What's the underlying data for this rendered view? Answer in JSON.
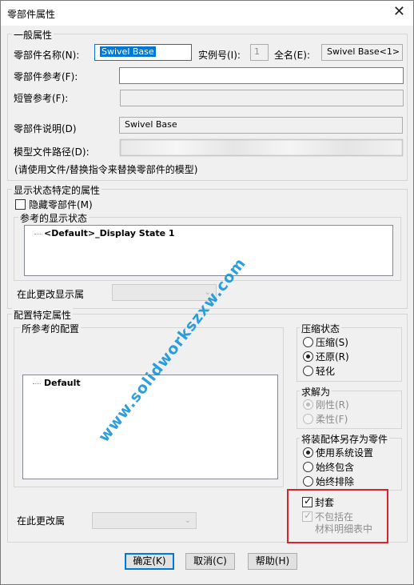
{
  "window": {
    "title": "零部件属性",
    "close_glyph": "✕"
  },
  "general": {
    "legend": "一般属性",
    "name_label": "零部件名称(N):",
    "name_value": "Swivel Base",
    "instance_label": "实例号(I):",
    "instance_value": "1",
    "fullname_label": "全名(E):",
    "fullname_value": "Swivel Base<1>",
    "ref_label": "零部件参考(F):",
    "ref_value": "",
    "short_ref_label": "短管参考(F):",
    "short_ref_value": "",
    "desc_label": "零部件说明(D)",
    "desc_value": "Swivel Base",
    "path_label": "模型文件路径(D):",
    "path_hint": "(请使用文件/替换指令来替换零部件的模型)"
  },
  "display": {
    "legend": "显示状态特定的属性",
    "hide_label": "隐藏零部件(M)",
    "ref_states_label": "参考的显示状态",
    "states": [
      "<Default>_Display State 1"
    ],
    "change_label": "在此更改显示属"
  },
  "config": {
    "legend": "配置特定属性",
    "ref_configs_label": "所参考的配置",
    "configs": [
      "Default"
    ],
    "change_label": "在此更改属",
    "suppress": {
      "legend": "压缩状态",
      "options": [
        "压缩(S)",
        "还原(R)",
        "轻化"
      ],
      "selected": 1
    },
    "solve": {
      "legend": "求解为",
      "options": [
        "刚性(R)",
        "柔性(F)"
      ],
      "selected": 0
    },
    "save_as": {
      "legend": "将装配体另存为零件",
      "options": [
        "使用系统设置",
        "始终包含",
        "始终排除"
      ],
      "selected": 0
    },
    "envelope_label": "封套",
    "exclude_bom_line1": "不包括在",
    "exclude_bom_line2": "材料明细表中"
  },
  "buttons": {
    "ok": "确定(K)",
    "cancel": "取消(C)",
    "help": "帮助(H)"
  },
  "watermark": "www.solidworkszxw.com",
  "colors": {
    "highlight_box": "#d9232e",
    "watermark": "#0a8fd8",
    "focus": "#0078d7"
  }
}
